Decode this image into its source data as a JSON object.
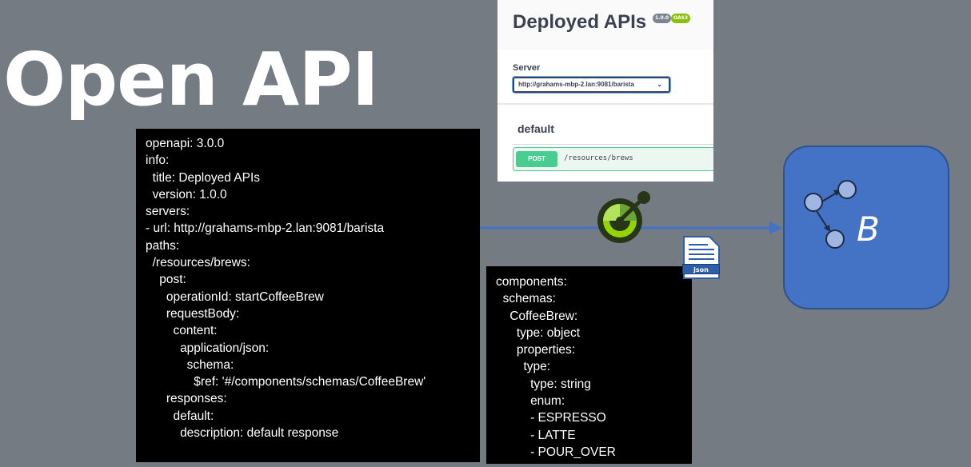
{
  "slide": {
    "title": "Open API"
  },
  "openapi_spec": {
    "lines": [
      "openapi: 3.0.0",
      "info:",
      "  title: Deployed APIs",
      "  version: 1.0.0",
      "servers:",
      "- url: http://grahams-mbp-2.lan:9081/barista",
      "paths:",
      "  /resources/brews:",
      "    post:",
      "      operationId: startCoffeeBrew",
      "      requestBody:",
      "        content:",
      "          application/json:",
      "            schema:",
      "              $ref: '#/components/schemas/CoffeeBrew'",
      "      responses:",
      "        default:",
      "          description: default response"
    ]
  },
  "components_spec": {
    "lines": [
      "components:",
      "  schemas:",
      "    CoffeeBrew:",
      "      type: object",
      "      properties:",
      "        type:",
      "          type: string",
      "          enum:",
      "          - ESPRESSO",
      "          - LATTE",
      "          - POUR_OVER"
    ]
  },
  "swagger_ui": {
    "title": "Deployed APIs",
    "version_badge": "1.0.0",
    "oas_badge": "OAS3",
    "server_label": "Server",
    "server_value": "http://grahams-mbp-2.lan:9081/barista",
    "section": "default",
    "operation": {
      "method": "POST",
      "path": "/resources/brews"
    }
  },
  "json_icon": {
    "label": "json"
  },
  "service_node": {
    "label": "B"
  },
  "colors": {
    "background": "#747b83",
    "code_bg": "#000000",
    "node_blue": "#4472c4",
    "arrow_blue": "#4472c4",
    "post_green": "#49cc90"
  }
}
